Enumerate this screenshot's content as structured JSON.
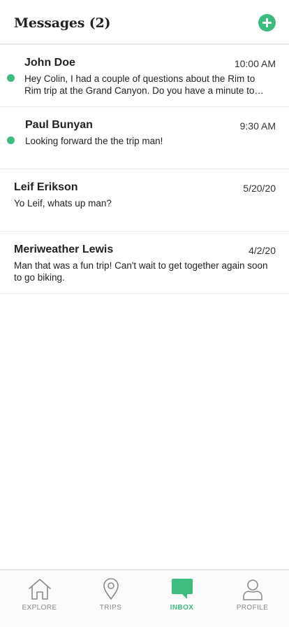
{
  "header": {
    "title": "Messages (2)"
  },
  "messages": [
    {
      "sender": "John Doe",
      "time": "10:00 AM",
      "preview": "Hey Colin, I had a couple of questions about the Rim to Rim trip at the Grand Canyon. Do you have a minute to talk?",
      "unread": true
    },
    {
      "sender": "Paul Bunyan",
      "time": "9:30 AM",
      "preview": "Looking forward the the trip man!",
      "unread": true
    },
    {
      "sender": "Leif Erikson",
      "time": "5/20/20",
      "preview": "Yo Leif, whats up man?",
      "unread": false
    },
    {
      "sender": "Meriweather Lewis",
      "time": "4/2/20",
      "preview": "Man that was a fun trip! Can't wait to get together again soon to go biking.",
      "unread": false
    }
  ],
  "tabs": [
    {
      "label": "EXPLORE",
      "icon": "home-icon",
      "active": false
    },
    {
      "label": "TRIPS",
      "icon": "map-pin-icon",
      "active": false
    },
    {
      "label": "INBOX",
      "icon": "chat-bubble-icon",
      "active": true
    },
    {
      "label": "PROFILE",
      "icon": "user-icon",
      "active": false
    }
  ],
  "colors": {
    "accent": "#3dbd7d",
    "inactive": "#8a8a8a",
    "text": "#222222"
  }
}
